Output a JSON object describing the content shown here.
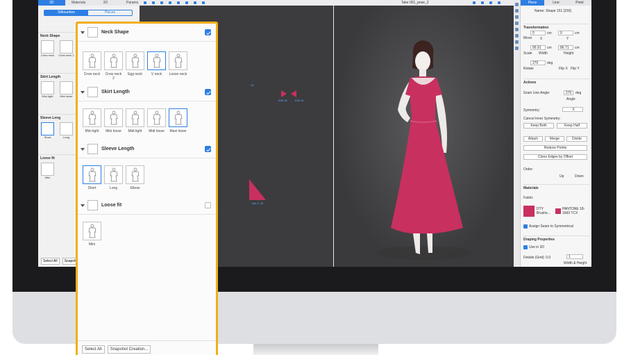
{
  "left_tabs": [
    "3D",
    "Materials",
    "3D",
    "Params"
  ],
  "library": {
    "segments": [
      "Silhouettes",
      "Pieces"
    ],
    "sections": [
      {
        "title": "Neck Shape",
        "items": [
          "Crew neck",
          "Crew neck 2",
          "Egg"
        ]
      },
      {
        "title": "Skirt Length",
        "items": [
          "Mini tight",
          "Mini loose",
          "Midi"
        ]
      },
      {
        "title": "Sleeve Leng",
        "items": [
          "Short",
          "Long",
          "Elb"
        ]
      },
      {
        "title": "Loose fit",
        "items": [
          "Mini"
        ]
      }
    ],
    "buttons": [
      "Select All",
      "Snapsh"
    ]
  },
  "viewport": {
    "take_label": "Take 001_pose_2"
  },
  "annotations": [
    "16",
    "Edit 18",
    "Edit 16",
    "line 2, 16"
  ],
  "panel": {
    "sections": [
      {
        "title": "Neck Shape",
        "checked": true,
        "items": [
          "Crew neck",
          "Crew neck 2",
          "Egg neck",
          "V neck",
          "Loose neck"
        ],
        "selected": 3
      },
      {
        "title": "Skirt Length",
        "checked": true,
        "items": [
          "Mini tight",
          "Mini loose",
          "Midi tight",
          "Midi loose",
          "Maxi loose"
        ],
        "selected": 4
      },
      {
        "title": "Sleeve Length",
        "checked": true,
        "items": [
          "Short",
          "Long",
          "Elbow"
        ],
        "selected": 0
      },
      {
        "title": "Loose fit",
        "checked": false,
        "items": [
          "Mini"
        ],
        "selected": -1
      }
    ],
    "footer": {
      "select_all": "Select All",
      "snapshot": "Snapshot Creation..."
    }
  },
  "right_panel": {
    "tabs": [
      "Piece",
      "Line",
      "Point"
    ],
    "name": "Name: Shape 151 [150]",
    "transformation": {
      "title": "Transformation",
      "move": {
        "label": "Move",
        "x": "0",
        "y": "0",
        "unit": "cm",
        "x_label": "X",
        "y_label": "Y"
      },
      "scale": {
        "label": "Scale",
        "w": "95.91",
        "h": "86.71",
        "unit": "cm",
        "w_label": "Width",
        "h_label": "Height"
      },
      "rotate": {
        "label": "Rotate",
        "value": "270",
        "unit": "deg",
        "flip_x": "Flip X",
        "flip_y": "Flip Y"
      }
    },
    "actions": {
      "title": "Actions",
      "grain": {
        "label": "Grain Line Angle:",
        "value": "270",
        "unit": "deg",
        "sub": "Angle"
      },
      "symmetry": {
        "label": "Symmetry:",
        "value": "X"
      },
      "cancel_inner": "Cancel Inner Symmetry:",
      "keep_both": "Keep Both",
      "keep_half": "Keep Half",
      "attach": "Attach",
      "merge": "Merge",
      "divide": "Divide",
      "reduce": "Reduce Points",
      "clone": "Clone Edges by Offset",
      "order": {
        "label": "Order:",
        "up": "Up",
        "down": "Down"
      }
    },
    "materials": {
      "title": "Materials",
      "fabric_label": "Fabric",
      "fabric_name": "DTY Brushe...",
      "pantone": "PANTONE 18-1660 TCX",
      "assign_seam": "Assign Seam to Symmetrical",
      "fabric_color": "#c8305f"
    },
    "draping": {
      "title": "Draping Properties",
      "use_3d": "Use in 3D",
      "details_label": "Details (Grid): 0.0",
      "details_value": "1",
      "wh": "Width & Height"
    }
  },
  "colors": {
    "accent": "#2d7fe3",
    "highlight": "#f2ad1a",
    "dress": "#c8305f"
  }
}
